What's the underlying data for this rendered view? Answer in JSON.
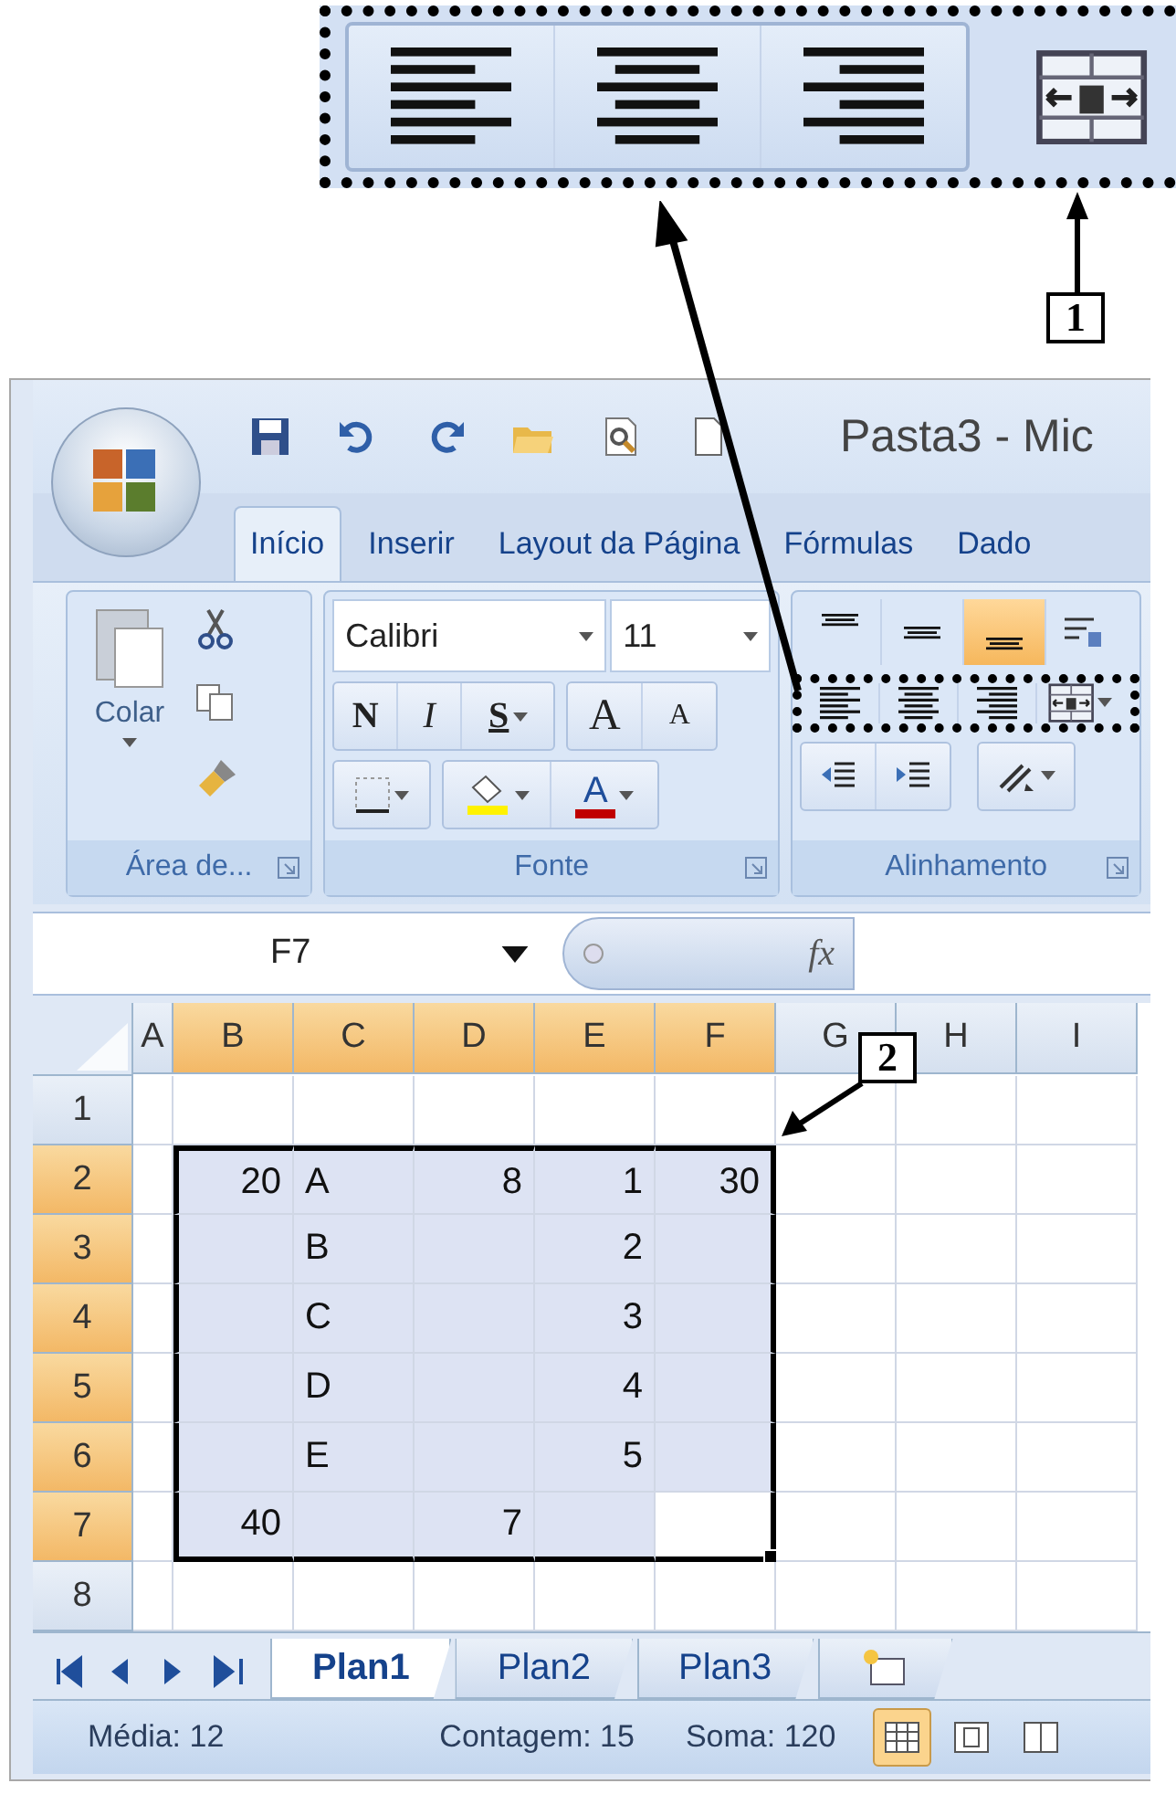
{
  "annotations": [
    {
      "label": "1"
    },
    {
      "label": "2"
    }
  ],
  "window": {
    "title": "Pasta3 - Mic"
  },
  "ribbon_tabs": [
    {
      "label": "Início",
      "selected": true
    },
    {
      "label": "Inserir",
      "selected": false
    },
    {
      "label": "Layout da Página",
      "selected": false
    },
    {
      "label": "Fórmulas",
      "selected": false
    },
    {
      "label": "Dado",
      "selected": false
    }
  ],
  "clipboard": {
    "paste": "Colar",
    "group_label": "Área de..."
  },
  "font": {
    "name": "Calibri",
    "size": "11",
    "bold": "N",
    "italic": "I",
    "underline": "S",
    "grow": "A",
    "shrink": "A",
    "font_color": "A",
    "group_label": "Fonte"
  },
  "alignment": {
    "vertical": [
      {
        "selected": false
      },
      {
        "selected": false
      },
      {
        "selected": true
      }
    ],
    "horizontal": [
      {
        "selected": false
      },
      {
        "selected": false
      },
      {
        "selected": false
      }
    ],
    "group_label": "Alinhamento"
  },
  "formula_bar": {
    "name_box": "F7",
    "fx": "fx"
  },
  "columns": [
    {
      "label": "A",
      "selected": false
    },
    {
      "label": "B",
      "selected": true
    },
    {
      "label": "C",
      "selected": true
    },
    {
      "label": "D",
      "selected": true
    },
    {
      "label": "E",
      "selected": true
    },
    {
      "label": "F",
      "selected": true
    },
    {
      "label": "G",
      "selected": false
    },
    {
      "label": "H",
      "selected": false
    },
    {
      "label": "I",
      "selected": false
    }
  ],
  "rows": [
    {
      "label": "1",
      "selected": false,
      "cells": [
        null,
        null,
        null,
        null,
        null,
        null,
        null,
        null,
        null
      ]
    },
    {
      "label": "2",
      "selected": true,
      "cells": [
        null,
        {
          "text": "20",
          "kind": "number"
        },
        {
          "text": "A",
          "kind": "text"
        },
        {
          "text": "8",
          "kind": "number"
        },
        {
          "text": "1",
          "kind": "number"
        },
        {
          "text": "30",
          "kind": "number"
        },
        null,
        null,
        null
      ]
    },
    {
      "label": "3",
      "selected": true,
      "cells": [
        null,
        null,
        {
          "text": "B",
          "kind": "text"
        },
        null,
        {
          "text": "2",
          "kind": "number"
        },
        null,
        null,
        null,
        null
      ]
    },
    {
      "label": "4",
      "selected": true,
      "cells": [
        null,
        null,
        {
          "text": "C",
          "kind": "text"
        },
        null,
        {
          "text": "3",
          "kind": "number"
        },
        null,
        null,
        null,
        null
      ]
    },
    {
      "label": "5",
      "selected": true,
      "cells": [
        null,
        null,
        {
          "text": "D",
          "kind": "text"
        },
        null,
        {
          "text": "4",
          "kind": "number"
        },
        null,
        null,
        null,
        null
      ]
    },
    {
      "label": "6",
      "selected": true,
      "cells": [
        null,
        null,
        {
          "text": "E",
          "kind": "text"
        },
        null,
        {
          "text": "5",
          "kind": "number"
        },
        null,
        null,
        null,
        null
      ]
    },
    {
      "label": "7",
      "selected": true,
      "cells": [
        null,
        {
          "text": "40",
          "kind": "number"
        },
        null,
        {
          "text": "7",
          "kind": "number"
        },
        null,
        {
          "active": true
        },
        null,
        null,
        null
      ]
    },
    {
      "label": "8",
      "selected": false,
      "cells": [
        null,
        null,
        null,
        null,
        null,
        null,
        null,
        null,
        null
      ]
    }
  ],
  "sheet_tabs": [
    {
      "label": "Plan1",
      "selected": true
    },
    {
      "label": "Plan2",
      "selected": false
    },
    {
      "label": "Plan3",
      "selected": false
    }
  ],
  "status_bar": {
    "average": "Média: 12",
    "count": "Contagem: 15",
    "sum": "Soma: 120",
    "views": [
      {
        "selected": true
      },
      {
        "selected": false
      },
      {
        "selected": false
      }
    ]
  }
}
